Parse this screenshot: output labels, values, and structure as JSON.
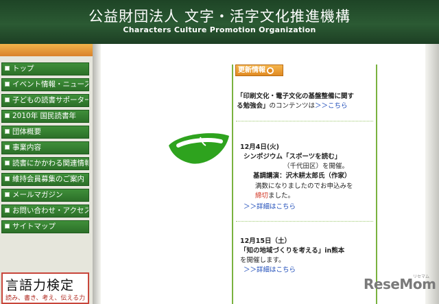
{
  "header": {
    "title": "公益財団法人 文字・活字文化推進機構",
    "subtitle": "Characters Culture Promotion Organization"
  },
  "nav": {
    "items": [
      {
        "label": "トップ"
      },
      {
        "label": "イベント情報・ニュース"
      },
      {
        "label": "子どもの読書サポーター"
      },
      {
        "label": "2010年 国民読書年"
      },
      {
        "label": "団体概要"
      },
      {
        "label": "事業内容"
      },
      {
        "label": "読書にかかわる関連情報"
      },
      {
        "label": "維持会員募集のご案内"
      },
      {
        "label": "メールマガジン"
      },
      {
        "label": "お問い合わせ・アクセス"
      },
      {
        "label": "サイトマップ"
      }
    ]
  },
  "banner": {
    "title": "言語力検定",
    "tagline": "読み、書き、考え、伝える力"
  },
  "updates": {
    "heading": "更新情報",
    "intro_line1": "「印刷文化・電子文化の基盤整備に関す",
    "intro_line2_bold": "る勉強会」",
    "intro_line2_rest": "のコンテンツは",
    "intro_link": "＞＞こちら",
    "event1": {
      "date": "12月4日(火)",
      "line1": "シンポジウム「スポーツを読む」",
      "line2": "（千代田区）を開催。",
      "line3": "基調講演：沢木耕太郎氏（作家）",
      "line4": "満数になりましたのでお申込みを",
      "line5_red": "締切",
      "line5_rest": "ました。",
      "link": "＞＞詳細はこちら"
    },
    "event2": {
      "date": "12月15日（土）",
      "line1": "「知の地域づくりを考える」in熊本",
      "line2": "を開催します。",
      "link": "＞＞詳細はこちら"
    }
  },
  "watermark": {
    "text": "ReseMom",
    "sub": "リセマム"
  },
  "colors": {
    "header_green": "#2b5a33",
    "nav_green": "#2c7029",
    "accent_orange": "#e08a22",
    "panel_border": "#7ab23f",
    "logo_green": "#2ea31e",
    "link_blue": "#1a49b8",
    "alert_red": "#d0301e"
  }
}
